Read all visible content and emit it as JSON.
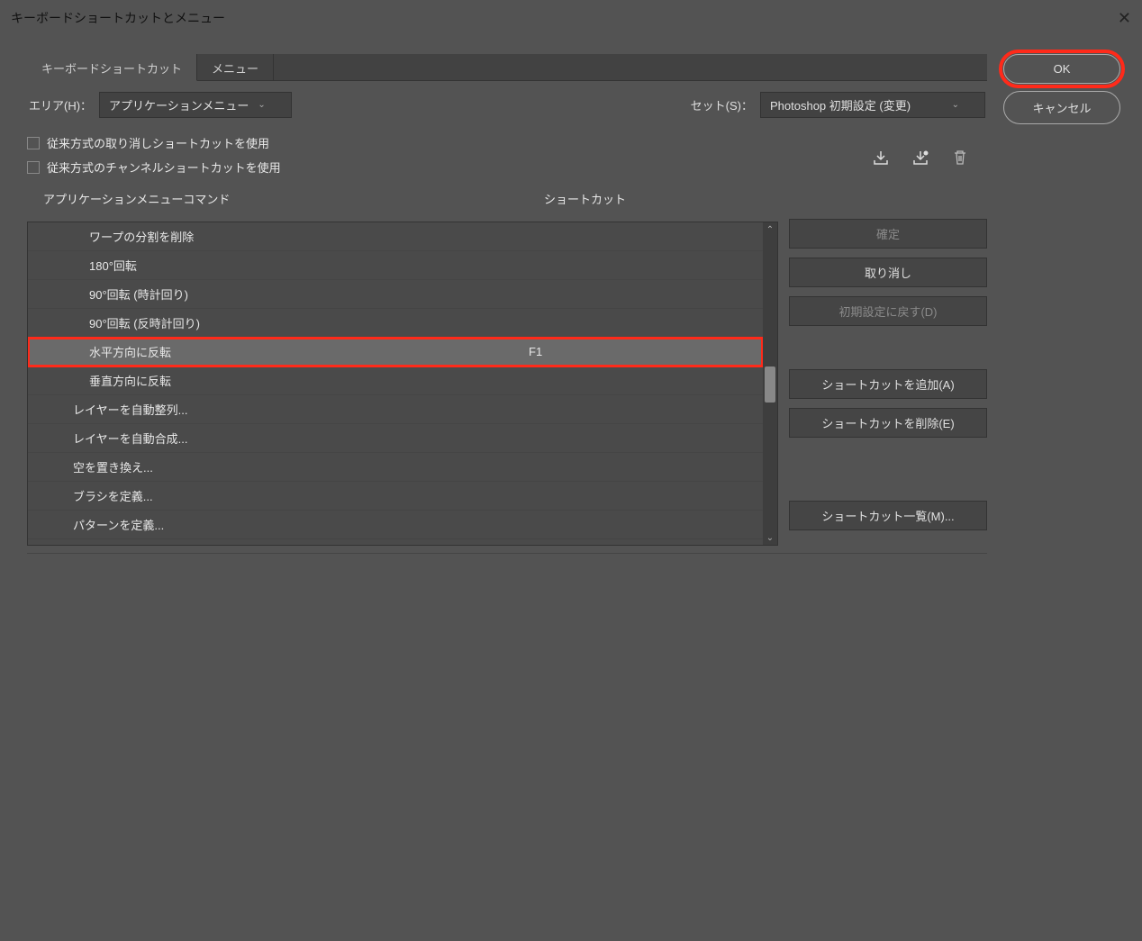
{
  "window": {
    "title": "キーボードショートカットとメニュー"
  },
  "tabs": {
    "shortcuts": "キーボードショートカット",
    "menus": "メニュー"
  },
  "area": {
    "label": "エリア(H)：",
    "value": "アプリケーションメニュー"
  },
  "set": {
    "label": "セット(S)：",
    "value": "Photoshop 初期設定 (変更)"
  },
  "checkboxes": {
    "undo": "従来方式の取り消しショートカットを使用",
    "channel": "従来方式のチャンネルショートカットを使用"
  },
  "headers": {
    "command": "アプリケーションメニューコマンド",
    "shortcut": "ショートカット"
  },
  "rows": [
    {
      "cmd": "ワープの分割を削除",
      "sc": "",
      "indent": 2
    },
    {
      "cmd": "180°回転",
      "sc": "",
      "indent": 2
    },
    {
      "cmd": "90°回転 (時計回り)",
      "sc": "",
      "indent": 2
    },
    {
      "cmd": "90°回転 (反時計回り)",
      "sc": "",
      "indent": 2
    },
    {
      "cmd": "水平方向に反転",
      "sc": "F1",
      "indent": 2,
      "selected": true,
      "highlight": true
    },
    {
      "cmd": "垂直方向に反転",
      "sc": "",
      "indent": 2
    },
    {
      "cmd": "レイヤーを自動整列...",
      "sc": "",
      "indent": 1
    },
    {
      "cmd": "レイヤーを自動合成...",
      "sc": "",
      "indent": 1
    },
    {
      "cmd": "空を置き換え...",
      "sc": "",
      "indent": 1
    },
    {
      "cmd": "ブラシを定義...",
      "sc": "",
      "indent": 1
    },
    {
      "cmd": "パターンを定義...",
      "sc": "",
      "indent": 1
    }
  ],
  "sideButtons": {
    "accept": "確定",
    "undo": "取り消し",
    "default": "初期設定に戻す(D)",
    "add": "ショートカットを追加(A)",
    "delete": "ショートカットを削除(E)",
    "summary": "ショートカット一覧(M)..."
  },
  "dialogButtons": {
    "ok": "OK",
    "cancel": "キャンセル"
  }
}
